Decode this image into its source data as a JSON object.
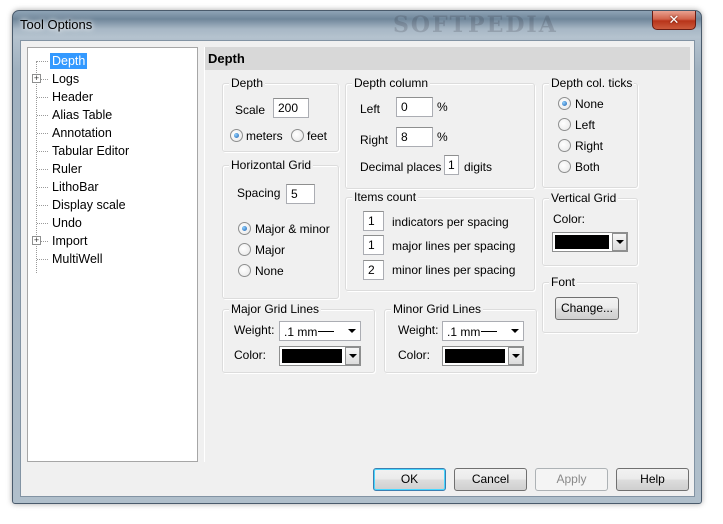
{
  "window": {
    "title": "Tool Options",
    "watermark": "SOFTPEDIA",
    "close_glyph": "✕"
  },
  "tree": {
    "items": [
      {
        "label": "Depth",
        "selected": true,
        "expandable": false
      },
      {
        "label": "Logs",
        "selected": false,
        "expandable": true
      },
      {
        "label": "Header",
        "selected": false,
        "expandable": false
      },
      {
        "label": "Alias Table",
        "selected": false,
        "expandable": false
      },
      {
        "label": "Annotation",
        "selected": false,
        "expandable": false
      },
      {
        "label": "Tabular Editor",
        "selected": false,
        "expandable": false
      },
      {
        "label": "Ruler",
        "selected": false,
        "expandable": false
      },
      {
        "label": "LithoBar",
        "selected": false,
        "expandable": false
      },
      {
        "label": "Display scale",
        "selected": false,
        "expandable": false
      },
      {
        "label": "Undo",
        "selected": false,
        "expandable": false
      },
      {
        "label": "Import",
        "selected": false,
        "expandable": true
      },
      {
        "label": "MultiWell",
        "selected": false,
        "expandable": false
      }
    ],
    "expander_glyph": "+"
  },
  "panel": {
    "header": "Depth",
    "depth_group": {
      "title": "Depth",
      "scale_label": "Scale",
      "scale_value": "200",
      "unit_meters": "meters",
      "unit_feet": "feet",
      "selected_unit": "meters"
    },
    "depth_column_group": {
      "title": "Depth column",
      "left_label": "Left",
      "left_value": "0",
      "left_unit": "%",
      "right_label": "Right",
      "right_value": "8",
      "right_unit": "%",
      "decimal_label": "Decimal places",
      "decimal_value": "1",
      "decimal_unit": "digits"
    },
    "ticks_group": {
      "title": "Depth col. ticks",
      "options": [
        "None",
        "Left",
        "Right",
        "Both"
      ],
      "selected": "None"
    },
    "horizontal_grid_group": {
      "title": "Horizontal Grid",
      "spacing_label": "Spacing",
      "spacing_value": "5",
      "options": [
        "Major & minor",
        "Major",
        "None"
      ],
      "selected": "Major & minor"
    },
    "items_count_group": {
      "title": "Items count",
      "rows": [
        {
          "value": "1",
          "label": "indicators per spacing"
        },
        {
          "value": "1",
          "label": "major lines per spacing"
        },
        {
          "value": "2",
          "label": "minor lines per spacing"
        }
      ]
    },
    "vertical_grid_group": {
      "title": "Vertical Grid",
      "color_label": "Color:",
      "color_value": "#000000"
    },
    "font_group": {
      "title": "Font",
      "change_button": "Change..."
    },
    "major_grid_group": {
      "title": "Major Grid Lines",
      "weight_label": "Weight:",
      "weight_value": ".1 mm",
      "color_label": "Color:",
      "color_value": "#000000"
    },
    "minor_grid_group": {
      "title": "Minor Grid Lines",
      "weight_label": "Weight:",
      "weight_value": ".1 mm",
      "color_label": "Color:",
      "color_value": "#000000"
    }
  },
  "buttons": {
    "ok": "OK",
    "cancel": "Cancel",
    "apply": "Apply",
    "help": "Help"
  },
  "colors": {
    "selection": "#3399ff",
    "close_button": "#c8442a",
    "default_button_border": "#3c7fb1"
  }
}
